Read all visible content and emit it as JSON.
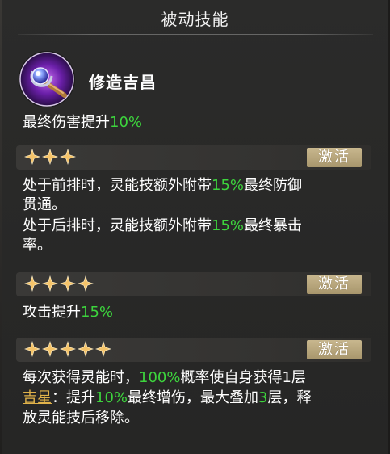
{
  "header": {
    "title": "被动技能"
  },
  "skill": {
    "name": "修造吉昌",
    "icon": "orb-staff-icon",
    "base_effect": {
      "prefix": "最终伤害提升",
      "value": "10%"
    }
  },
  "tiers": [
    {
      "stars": 3,
      "badge": "激活",
      "line1": {
        "a": "处于前排时，灵能技额外附带",
        "value": "15%",
        "b": "最终防御"
      },
      "line2": "贯通。",
      "line3": {
        "a": "处于后排时，灵能技额外附带",
        "value": "15%",
        "b": "最终暴击"
      },
      "line4": "率。"
    },
    {
      "stars": 4,
      "badge": "激活",
      "line1": {
        "a": "攻击提升",
        "value": "15%"
      }
    },
    {
      "stars": 5,
      "badge": "激活",
      "line1": {
        "a": "每次获得灵能时，",
        "value": "100%",
        "b": "概率使自身获得1层"
      },
      "line2": {
        "link": "吉星",
        "a": "：提升",
        "value": "10%",
        "b": "最终增伤，最大叠加",
        "stack": "3",
        "c": "层，释"
      },
      "line3": "放灵能技后移除。"
    }
  ],
  "colors": {
    "highlight_green": "#3dd43d",
    "link_gold": "#e0b24a",
    "badge_bg": "#b8a67c",
    "star_gold": "#f5c46a"
  }
}
